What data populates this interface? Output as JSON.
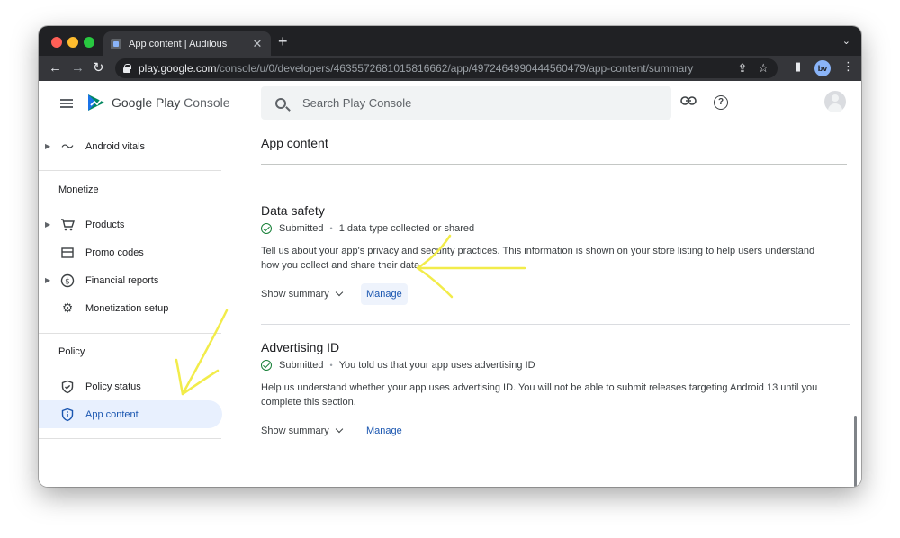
{
  "browser": {
    "tab_title": "App content | Audilous",
    "new_tab": "+",
    "tab_close": "✕",
    "url_host": "play.google.com",
    "url_path": "/console/u/0/developers/4635572681015816662/app/4972464990444560479/app-content/summary",
    "profile_initials": "bv"
  },
  "header": {
    "brand_primary": "Google Play",
    "brand_secondary": "Console",
    "search_placeholder": "Search Play Console"
  },
  "sidebar": {
    "android_vitals": "Android vitals",
    "monetize_heading": "Monetize",
    "products": "Products",
    "promo_codes": "Promo codes",
    "financial_reports": "Financial reports",
    "monetization_setup": "Monetization setup",
    "policy_heading": "Policy",
    "policy_status": "Policy status",
    "app_content": "App content"
  },
  "main": {
    "page_title": "App content",
    "data_safety": {
      "title": "Data safety",
      "status": "Submitted",
      "detail": "1 data type collected or shared",
      "description": "Tell us about your app's privacy and security practices. This information is shown on your store listing to help users understand how you collect and share their data.",
      "show_summary": "Show summary",
      "manage": "Manage"
    },
    "advertising_id": {
      "title": "Advertising ID",
      "status": "Submitted",
      "detail": "You told us that your app uses advertising ID",
      "description": "Help us understand whether your app uses advertising ID. You will not be able to submit releases targeting Android 13 until you complete this section.",
      "show_summary": "Show summary",
      "manage": "Manage"
    }
  },
  "colors": {
    "accent": "#1a56b0",
    "active_nav_bg": "#e8f0fe",
    "success": "#188038",
    "annotation": "#f2ec4a"
  }
}
